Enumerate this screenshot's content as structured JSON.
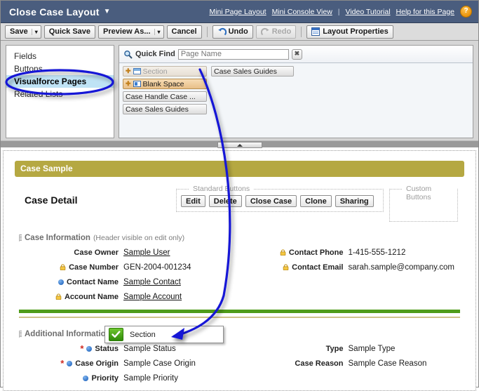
{
  "header": {
    "title": "Close Case Layout",
    "caret_icon": "chevron-down-icon",
    "links": [
      {
        "label": "Mini Page Layout"
      },
      {
        "label": "Mini Console View"
      },
      {
        "label": "Video Tutorial"
      },
      {
        "label": "Help for this Page"
      }
    ],
    "separator": "|",
    "help_icon_label": "?"
  },
  "toolbar": {
    "save_label": "Save",
    "save_caret": "▾",
    "quick_save_label": "Quick Save",
    "preview_as_label": "Preview As...",
    "preview_caret": "▾",
    "cancel_label": "Cancel",
    "undo_label": "Undo",
    "redo_label": "Redo",
    "layout_properties_label": "Layout Properties"
  },
  "categories": {
    "items": [
      {
        "label": "Fields",
        "selected": false
      },
      {
        "label": "Buttons",
        "selected": false
      },
      {
        "label": "Visualforce Pages",
        "selected": true
      },
      {
        "label": "Related Lists",
        "selected": false
      }
    ]
  },
  "quick_find": {
    "label": "Quick Find",
    "placeholder": "Page Name",
    "value": "",
    "clear_label": "✖",
    "search_icon": "magnifier-icon"
  },
  "palette": {
    "column_one": [
      {
        "label": "Section",
        "state": "dim",
        "has_plus": true,
        "icon": "section-icon"
      },
      {
        "label": "Blank Space",
        "state": "hot",
        "has_plus": true,
        "icon": "blank-space-icon"
      },
      {
        "label": "Case Handle Case ...",
        "state": "plain",
        "has_plus": false,
        "icon": ""
      },
      {
        "label": "Case Sales Guides",
        "state": "plain",
        "has_plus": false,
        "icon": ""
      }
    ],
    "column_two": [
      {
        "label": "Case Sales Guides",
        "state": "plain",
        "has_plus": false,
        "icon": ""
      }
    ]
  },
  "splitter": {
    "collapse_icon": "triangle-up-icon"
  },
  "preview": {
    "banner_title": "Case Sample",
    "detail_title": "Case Detail",
    "standard_buttons_legend": "Standard Buttons",
    "custom_buttons_legend": "Custom Buttons",
    "standard_buttons": [
      "Edit",
      "Delete",
      "Close Case",
      "Clone",
      "Sharing"
    ],
    "custom_buttons": [],
    "sections": [
      {
        "title": "Case Information",
        "note": "(Header visible on edit only)",
        "left_fields": [
          {
            "label": "Case Owner",
            "value": "Sample User",
            "is_link": true,
            "icons": []
          },
          {
            "label": "Case Number",
            "value": "GEN-2004-001234",
            "is_link": false,
            "icons": [
              "lock-icon"
            ]
          },
          {
            "label": "Contact Name",
            "value": "Sample Contact",
            "is_link": true,
            "icons": [
              "blue-dot-icon"
            ]
          },
          {
            "label": "Account Name",
            "value": "Sample Account",
            "is_link": true,
            "icons": [
              "lock-icon"
            ]
          }
        ],
        "right_fields": [
          {
            "label": "Contact Phone",
            "value": "1-415-555-1212",
            "is_link": false,
            "icons": [
              "lock-icon"
            ]
          },
          {
            "label": "Contact Email",
            "value": "sarah.sample@company.com",
            "is_link": false,
            "icons": [
              "lock-icon"
            ]
          }
        ]
      },
      {
        "title": "Additional Information",
        "note": "",
        "left_fields": [
          {
            "label": "Status",
            "value": "Sample Status",
            "is_link": false,
            "icons": [
              "required-icon",
              "blue-dot-icon"
            ]
          },
          {
            "label": "Case Origin",
            "value": "Sample Case Origin",
            "is_link": false,
            "icons": [
              "required-icon",
              "blue-dot-icon"
            ]
          },
          {
            "label": "Priority",
            "value": "Sample Priority",
            "is_link": false,
            "icons": [
              "blue-dot-icon"
            ]
          }
        ],
        "right_fields": [
          {
            "label": "Type",
            "value": "Sample Type",
            "is_link": false,
            "icons": []
          },
          {
            "label": "Case Reason",
            "value": "Sample Case Reason",
            "is_link": false,
            "icons": []
          }
        ]
      }
    ]
  },
  "drag_tooltip": {
    "label": "Section",
    "check_icon": "green-check-icon"
  },
  "annotation": {
    "ellipse_target": "Visualforce Pages",
    "arrow_color": "#1417d6",
    "ellipse_color": "#1417d6"
  },
  "colors": {
    "titlebar": "#4a5d7e",
    "banner": "#b5a842",
    "green_divider": "#4f9c19",
    "tan_divider": "#cfc38a",
    "selected_category": "#bfe3f5",
    "annotation": "#1417d6"
  }
}
